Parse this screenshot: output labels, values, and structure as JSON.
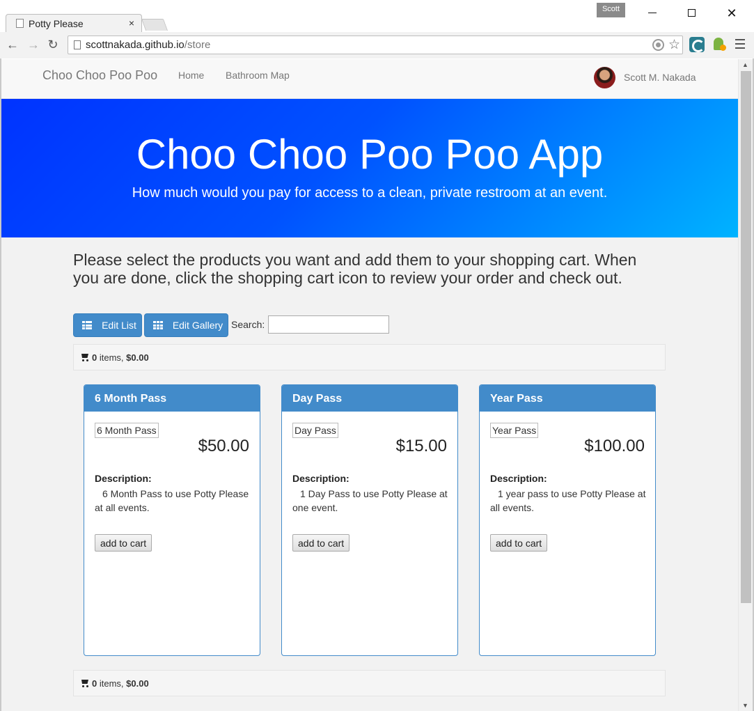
{
  "browser": {
    "tab_title": "Potty Please",
    "tab_close": "×",
    "profile_name": "Scott",
    "url_host": "scottnakada.github.io",
    "url_path": "/store"
  },
  "site": {
    "brand": "Choo Choo Poo Poo",
    "nav": {
      "home": "Home",
      "map": "Bathroom Map"
    },
    "user_name": "Scott M. Nakada"
  },
  "hero": {
    "title": "Choo Choo Poo Poo App",
    "subtitle": "How much would you pay for access to a clean, private restroom at an event."
  },
  "intro_text": "Please select the products you want and add them to your shopping cart. When you are done, click the shopping cart icon to review your order and check out.",
  "controls": {
    "edit_list": "Edit List",
    "edit_gallery": "Edit Gallery",
    "search_label": "Search:",
    "search_value": ""
  },
  "cart": {
    "count": "0",
    "items_label": " items, ",
    "total": "$0.00"
  },
  "products": [
    {
      "name": "6 Month Pass",
      "tag": "6 Month Pass",
      "price": "$50.00",
      "desc_label": "Description:",
      "description": "6 Month Pass to use Potty Please at all events.",
      "button": "add to cart"
    },
    {
      "name": "Day Pass",
      "tag": "Day Pass",
      "price": "$15.00",
      "desc_label": "Description:",
      "description": "1 Day Pass to use Potty Please at one event.",
      "button": "add to cart"
    },
    {
      "name": "Year Pass",
      "tag": "Year Pass",
      "price": "$100.00",
      "desc_label": "Description:",
      "description": "1 year pass to use Potty Please at all events.",
      "button": "add to cart"
    }
  ],
  "colors": {
    "primary": "#428bca",
    "hero_start": "#0033ff",
    "hero_end": "#00b3ff"
  }
}
